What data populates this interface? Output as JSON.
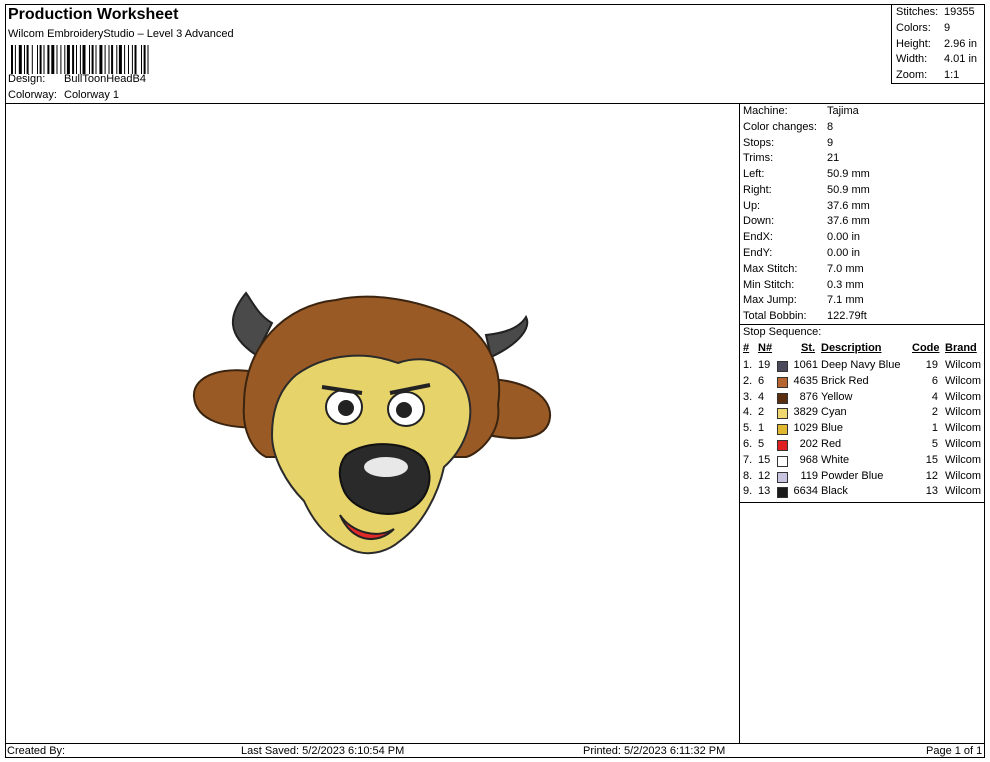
{
  "header": {
    "title": "Production Worksheet",
    "subtitle": "Wilcom EmbroideryStudio – Level 3 Advanced",
    "design_label": "Design:",
    "design_value": "BullToonHeadB4",
    "colorway_label": "Colorway:",
    "colorway_value": "Colorway 1"
  },
  "summary": [
    {
      "label": "Stitches:",
      "value": "19355"
    },
    {
      "label": "Colors:",
      "value": "9"
    },
    {
      "label": "Height:",
      "value": "2.96 in"
    },
    {
      "label": "Width:",
      "value": "4.01 in"
    },
    {
      "label": "Zoom:",
      "value": "1:1"
    }
  ],
  "specs": [
    {
      "label": "Machine:",
      "value": "Tajima"
    },
    {
      "label": "Color changes:",
      "value": "8"
    },
    {
      "label": "Stops:",
      "value": "9"
    },
    {
      "label": "Trims:",
      "value": "21"
    },
    {
      "label": "Left:",
      "value": "50.9 mm"
    },
    {
      "label": "Right:",
      "value": "50.9 mm"
    },
    {
      "label": "Up:",
      "value": "37.6 mm"
    },
    {
      "label": "Down:",
      "value": "37.6 mm"
    },
    {
      "label": "EndX:",
      "value": "0.00 in"
    },
    {
      "label": "EndY:",
      "value": "0.00 in"
    },
    {
      "label": "Max Stitch:",
      "value": "7.0 mm"
    },
    {
      "label": "Min Stitch:",
      "value": "0.3 mm"
    },
    {
      "label": "Max Jump:",
      "value": "7.1 mm"
    },
    {
      "label": "Total Bobbin:",
      "value": "122.79ft"
    }
  ],
  "stop_sequence": {
    "title": "Stop Sequence:",
    "headers": {
      "num": "#",
      "n": "N#",
      "st": "St.",
      "description": "Description",
      "code": "Code",
      "brand": "Brand"
    },
    "rows": [
      {
        "num": "1.",
        "n": "19",
        "color": "#4a4a5c",
        "st": "1061",
        "description": "Deep Navy Blue",
        "code": "19",
        "brand": "Wilcom"
      },
      {
        "num": "2.",
        "n": "6",
        "color": "#b5652f",
        "st": "4635",
        "description": "Brick Red",
        "code": "6",
        "brand": "Wilcom"
      },
      {
        "num": "3.",
        "n": "4",
        "color": "#5a2f10",
        "st": "876",
        "description": "Yellow",
        "code": "4",
        "brand": "Wilcom"
      },
      {
        "num": "4.",
        "n": "2",
        "color": "#f0d870",
        "st": "3829",
        "description": "Cyan",
        "code": "2",
        "brand": "Wilcom"
      },
      {
        "num": "5.",
        "n": "1",
        "color": "#e0b830",
        "st": "1029",
        "description": "Blue",
        "code": "1",
        "brand": "Wilcom"
      },
      {
        "num": "6.",
        "n": "5",
        "color": "#e02020",
        "st": "202",
        "description": "Red",
        "code": "5",
        "brand": "Wilcom"
      },
      {
        "num": "7.",
        "n": "15",
        "color": "#ffffff",
        "st": "968",
        "description": "White",
        "code": "15",
        "brand": "Wilcom"
      },
      {
        "num": "8.",
        "n": "12",
        "color": "#c8c4e0",
        "st": "119",
        "description": "Powder Blue",
        "code": "12",
        "brand": "Wilcom"
      },
      {
        "num": "9.",
        "n": "13",
        "color": "#1a1a1a",
        "st": "6634",
        "description": "Black",
        "code": "13",
        "brand": "Wilcom"
      }
    ]
  },
  "footer": {
    "created_by": "Created By:",
    "last_saved": "Last Saved: 5/2/2023 6:10:54 PM",
    "printed": "Printed: 5/2/2023 6:11:32 PM",
    "page": "Page 1 of 1"
  },
  "colors": {
    "fur": "#9a5a26",
    "fur_dark": "#6e3a14",
    "horn": "#4a4a4a",
    "face": "#e6d36a",
    "nose": "#2a2a2a",
    "tongue": "#e02a2a"
  }
}
